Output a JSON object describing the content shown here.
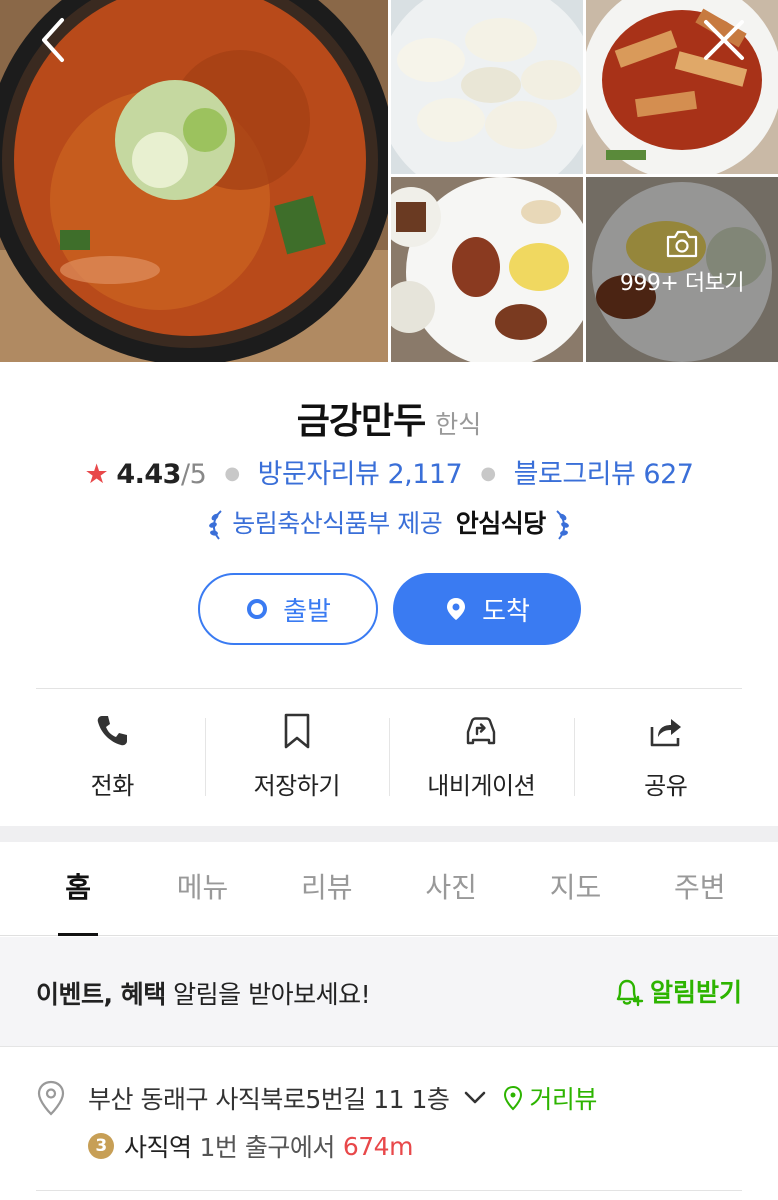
{
  "header": {
    "photos": [
      {
        "name": "soup-photo"
      },
      {
        "name": "dumplings-photo"
      },
      {
        "name": "tteok-photo"
      },
      {
        "name": "side-dish-photo"
      },
      {
        "name": "more-photo"
      }
    ],
    "more_label": "999+ 더보기"
  },
  "place": {
    "name": "금강만두",
    "category": "한식",
    "rating": "4.43",
    "rating_max": "/5",
    "visitor_reviews": "방문자리뷰 2,117",
    "blog_reviews": "블로그리뷰 627",
    "cert_text": "농림축산식품부 제공",
    "cert_strong": "안심식당"
  },
  "route": {
    "start_label": "출발",
    "arrive_label": "도착"
  },
  "actions": [
    {
      "label": "전화",
      "icon": "phone-icon"
    },
    {
      "label": "저장하기",
      "icon": "bookmark-icon"
    },
    {
      "label": "내비게이션",
      "icon": "car-navigation-icon"
    },
    {
      "label": "공유",
      "icon": "share-icon"
    }
  ],
  "tabs": [
    {
      "label": "홈",
      "active": true
    },
    {
      "label": "메뉴"
    },
    {
      "label": "리뷰"
    },
    {
      "label": "사진"
    },
    {
      "label": "지도"
    },
    {
      "label": "주변"
    }
  ],
  "notice": {
    "bold": "이벤트, 혜택",
    "text": " 알림을 받아보세요!",
    "button": "알림받기"
  },
  "address": {
    "text": "부산 동래구 사직북로5번길 11 1층",
    "street_view": "거리뷰",
    "line_number": "3",
    "station": "사직역",
    "exit": "1번 출구에서",
    "distance": "674m"
  },
  "colors": {
    "accent_blue": "#3a7bf2",
    "link_blue": "#3a6fd8",
    "green": "#2db400",
    "star_red": "#e8484a",
    "line3_badge": "#c79f56"
  }
}
